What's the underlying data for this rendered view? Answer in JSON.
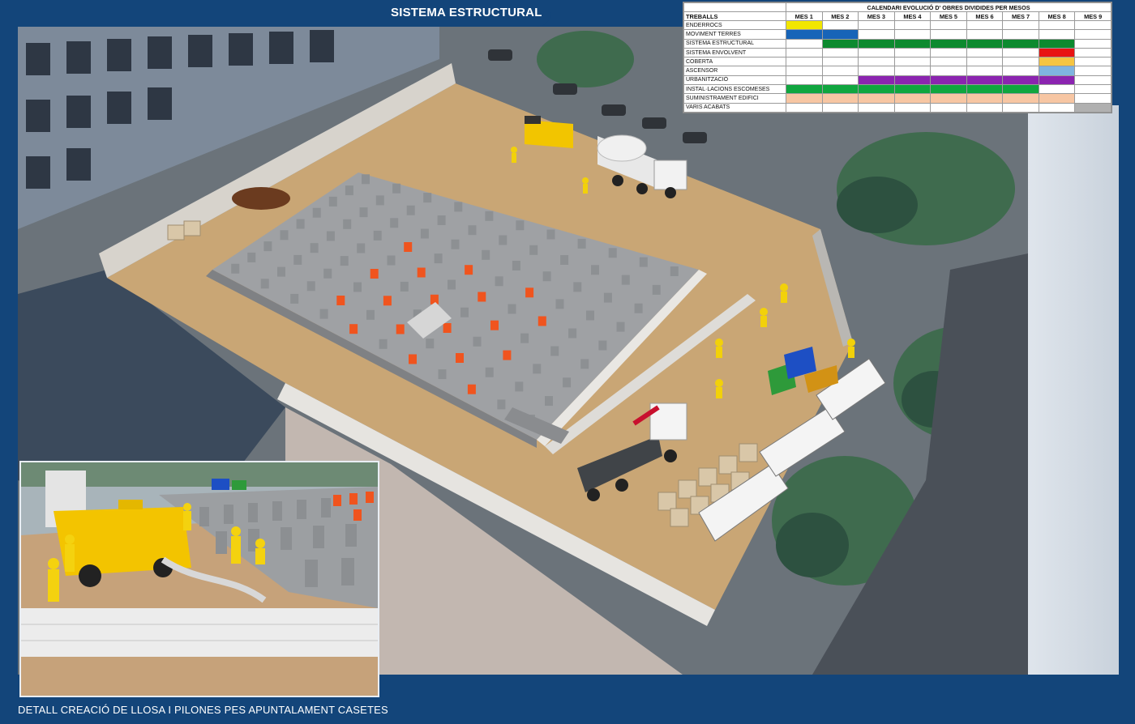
{
  "header": {
    "title": "SISTEMA ESTRUCTURAL"
  },
  "caption": "DETALL CREACIÓ DE LLOSA I PILONES PES APUNTALAMENT CASETES",
  "schedule": {
    "title": "CALENDARI EVOLUCIÓ D' OBRES DIVIDIDES PER MESOS",
    "task_header": "TREBALLS",
    "months": [
      "MES 1",
      "MES 2",
      "MES 3",
      "MES 4",
      "MES 5",
      "MES 6",
      "MES 7",
      "MES 8",
      "MES 9"
    ],
    "rows": [
      {
        "task": "ENDERROCS",
        "color": "#f2e600",
        "start": 1,
        "end": 1
      },
      {
        "task": "MOVIMENT TERRES",
        "color": "#1764b8",
        "start": 1,
        "end": 2
      },
      {
        "task": "SISTEMA ESTRUCTURAL",
        "color": "#0d8a2f",
        "start": 2,
        "end": 8
      },
      {
        "task": "SISTEMA ENVOLVENT",
        "color": "#e81313",
        "start": 8,
        "end": 8
      },
      {
        "task": "COBERTA",
        "color": "#f5c542",
        "start": 8,
        "end": 8
      },
      {
        "task": "ASCENSOR",
        "color": "#7fb4e0",
        "start": 8,
        "end": 8
      },
      {
        "task": "URBANITZACIÓ",
        "color": "#8b24b0",
        "start": 3,
        "end": 8
      },
      {
        "task": "INSTAL·LACIONS ESCOMESES",
        "color": "#10a63f",
        "start": 1,
        "end": 7
      },
      {
        "task": "SUMINISTRAMENT EDIFICI",
        "color": "#f7c6a3",
        "start": 1,
        "end": 8
      },
      {
        "task": "VARIS ACABATS",
        "color": "#b0b0b0",
        "start": 9,
        "end": 9
      }
    ]
  },
  "colors": {
    "frame": "#13457a",
    "pillar": "#f0541e",
    "soil": "#c9a675",
    "concrete": "#a9abad"
  }
}
